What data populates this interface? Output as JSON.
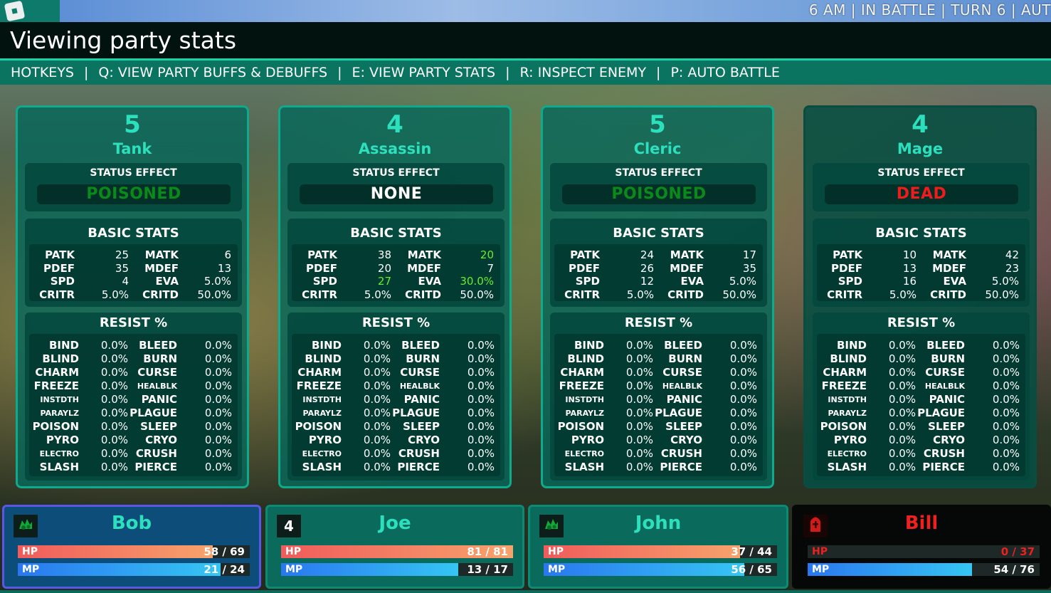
{
  "top_bar": {
    "info": "6 AM  |  IN BATTLE  |  TURN 6  |  AUT"
  },
  "title": "Viewing party stats",
  "hotkeys": {
    "items": [
      "HOTKEYS",
      "Q: VIEW PARTY BUFFS & DEBUFFS",
      "E: VIEW PARTY STATS",
      "R: INSPECT ENEMY",
      "P: AUTO BATTLE"
    ]
  },
  "labels": {
    "status_effect": "STATUS EFFECT",
    "basic_stats": "BASIC STATS",
    "resist": "RESIST %"
  },
  "colors": {
    "poisoned": "#0a8a1a",
    "none": "#ffffff",
    "dead": "#ee1c1c",
    "boosted": "#66ee33",
    "accent": "#2de0bd"
  },
  "party": [
    {
      "level": "5",
      "class": "Tank",
      "status": "POISONED",
      "status_color": "#0a8a1a",
      "dead": false,
      "stats": [
        [
          "PATK",
          "25",
          "MATK",
          "6"
        ],
        [
          "PDEF",
          "35",
          "MDEF",
          "13"
        ],
        [
          "SPD",
          "4",
          "EVA",
          "5.0%"
        ],
        [
          "CRITR",
          "5.0%",
          "CRITD",
          "50.0%"
        ]
      ],
      "highlight": []
    },
    {
      "level": "4",
      "class": "Assassin",
      "status": "NONE",
      "status_color": "#ffffff",
      "dead": false,
      "stats": [
        [
          "PATK",
          "38",
          "MATK",
          "20"
        ],
        [
          "PDEF",
          "20",
          "MDEF",
          "7"
        ],
        [
          "SPD",
          "27",
          "EVA",
          "30.0%"
        ],
        [
          "CRITR",
          "5.0%",
          "CRITD",
          "50.0%"
        ]
      ],
      "highlight": [
        "MATK",
        "SPD",
        "EVA"
      ]
    },
    {
      "level": "5",
      "class": "Cleric",
      "status": "POISONED",
      "status_color": "#0a8a1a",
      "dead": false,
      "stats": [
        [
          "PATK",
          "24",
          "MATK",
          "17"
        ],
        [
          "PDEF",
          "26",
          "MDEF",
          "35"
        ],
        [
          "SPD",
          "12",
          "EVA",
          "5.0%"
        ],
        [
          "CRITR",
          "5.0%",
          "CRITD",
          "50.0%"
        ]
      ],
      "highlight": []
    },
    {
      "level": "4",
      "class": "Mage",
      "status": "DEAD",
      "status_color": "#ee1c1c",
      "dead": true,
      "stats": [
        [
          "PATK",
          "10",
          "MATK",
          "42"
        ],
        [
          "PDEF",
          "13",
          "MDEF",
          "23"
        ],
        [
          "SPD",
          "16",
          "EVA",
          "5.0%"
        ],
        [
          "CRITR",
          "5.0%",
          "CRITD",
          "50.0%"
        ]
      ],
      "highlight": []
    }
  ],
  "resist": [
    [
      "BIND",
      "0.0%",
      "BLEED",
      "0.0%"
    ],
    [
      "BLIND",
      "0.0%",
      "BURN",
      "0.0%"
    ],
    [
      "CHARM",
      "0.0%",
      "CURSE",
      "0.0%"
    ],
    [
      "FREEZE",
      "0.0%",
      "HEALBLK",
      "0.0%"
    ],
    [
      "INSTDTH",
      "0.0%",
      "PANIC",
      "0.0%"
    ],
    [
      "PARAYLZ",
      "0.0%",
      "PLAGUE",
      "0.0%"
    ],
    [
      "POISON",
      "0.0%",
      "SLEEP",
      "0.0%"
    ],
    [
      "PYRO",
      "0.0%",
      "CRYO",
      "0.0%"
    ],
    [
      "ELECTRO",
      "0.0%",
      "CRUSH",
      "0.0%"
    ],
    [
      "SLASH",
      "0.0%",
      "PIERCE",
      "0.0%"
    ]
  ],
  "small_resist_labels": [
    "HEALBLK",
    "INSTDTH",
    "PARAYLZ",
    "ELECTRO"
  ],
  "members": [
    {
      "name": "Bob",
      "badge": "poison-icon",
      "badge_text": "",
      "hp": "58 / 69",
      "mp": "21 / 24",
      "hp_frac": 0.84,
      "mp_frac": 0.875,
      "selected": true,
      "dead": false
    },
    {
      "name": "Joe",
      "badge": "turn-counter",
      "badge_text": "4",
      "hp": "81 / 81",
      "mp": "13 / 17",
      "hp_frac": 1.0,
      "mp_frac": 0.765,
      "selected": false,
      "dead": false
    },
    {
      "name": "John",
      "badge": "poison-icon",
      "badge_text": "",
      "hp": "37 / 44",
      "mp": "56 / 65",
      "hp_frac": 0.84,
      "mp_frac": 0.86,
      "selected": false,
      "dead": false
    },
    {
      "name": "Bill",
      "badge": "tombstone-icon",
      "badge_text": "",
      "hp": "0 / 37",
      "mp": "54 / 76",
      "hp_frac": 0.0,
      "mp_frac": 0.71,
      "selected": false,
      "dead": true
    }
  ],
  "bar_labels": {
    "hp": "HP",
    "mp": "MP"
  }
}
